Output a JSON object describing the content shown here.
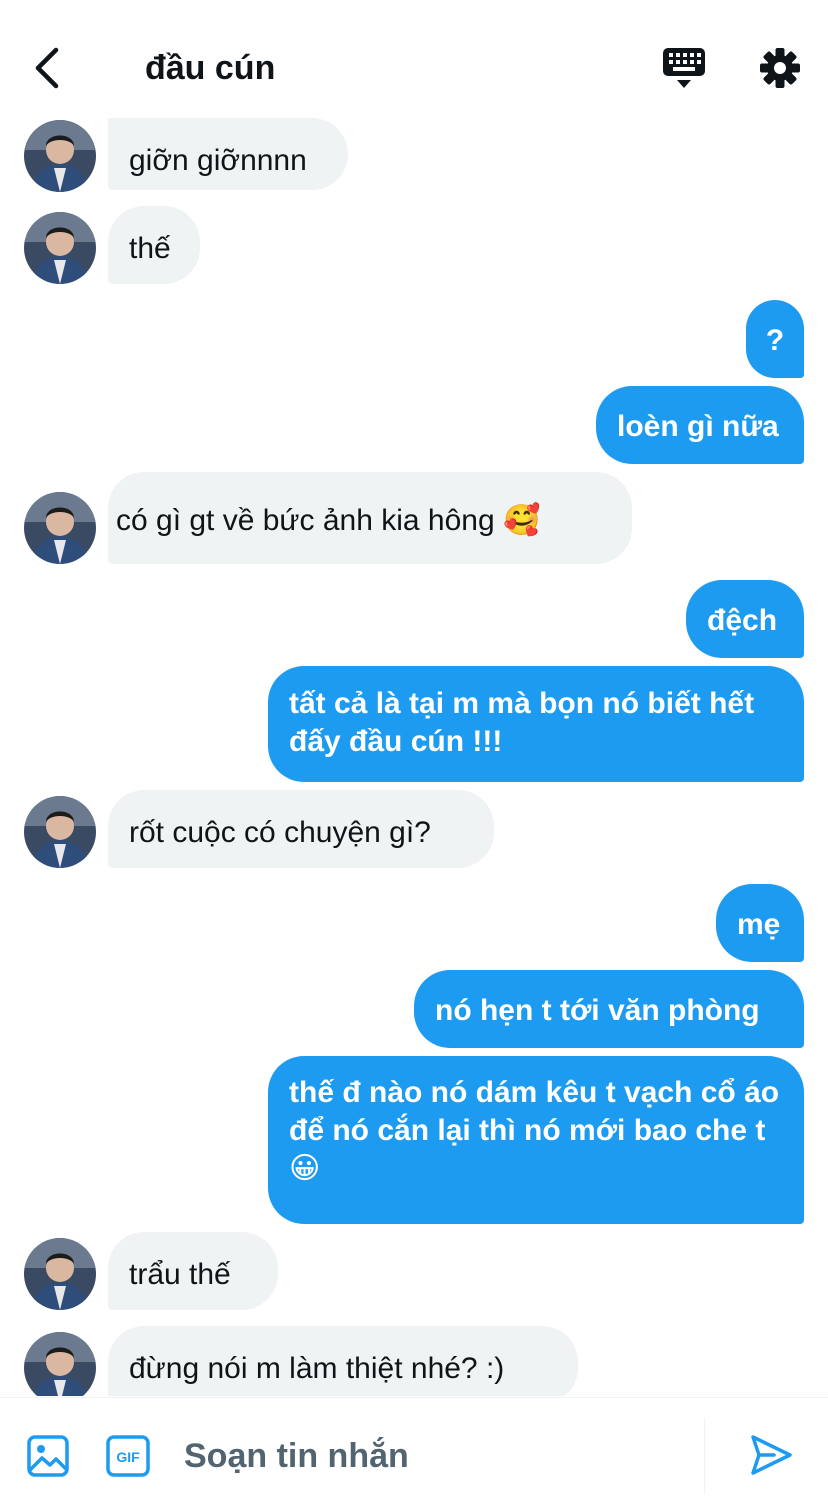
{
  "header": {
    "title": "đầu cún",
    "back_icon": "chevron-left-icon",
    "keyboard_icon": "keyboard-icon",
    "settings_icon": "gear-icon"
  },
  "colors": {
    "accent": "#1d9bf0",
    "incoming_bubble": "#eff3f4",
    "text": "#0f1419",
    "muted": "#536471"
  },
  "messages": [
    {
      "dir": "in",
      "text": "giỡn giỡnnnn"
    },
    {
      "dir": "in",
      "text": "thế"
    },
    {
      "dir": "out",
      "text": "?"
    },
    {
      "dir": "out",
      "text": "loèn gì nữa"
    },
    {
      "dir": "in",
      "text": " có gì gt về bức ảnh kia hông 🥰"
    },
    {
      "dir": "out",
      "text": "đệch"
    },
    {
      "dir": "out",
      "text": "tất cả là tại m mà bọn nó biết hết đấy đầu cún !!!"
    },
    {
      "dir": "in",
      "text": "rốt cuộc có chuyện gì?"
    },
    {
      "dir": "out",
      "text": "mẹ"
    },
    {
      "dir": "out",
      "text": "nó hẹn t tới văn phòng"
    },
    {
      "dir": "out",
      "text": "thế đ nào nó dám kêu t vạch cổ áo để nó cắn lại thì nó mới bao che t 😀"
    },
    {
      "dir": "in",
      "text": "trẩu thế"
    },
    {
      "dir": "in",
      "text": "đừng nói m làm thiệt nhé? :)"
    }
  ],
  "composer": {
    "placeholder": "Soạn tin nhắn",
    "image_icon": "image-icon",
    "gif_icon": "gif-icon",
    "gif_label": "GIF",
    "send_icon": "send-icon"
  }
}
